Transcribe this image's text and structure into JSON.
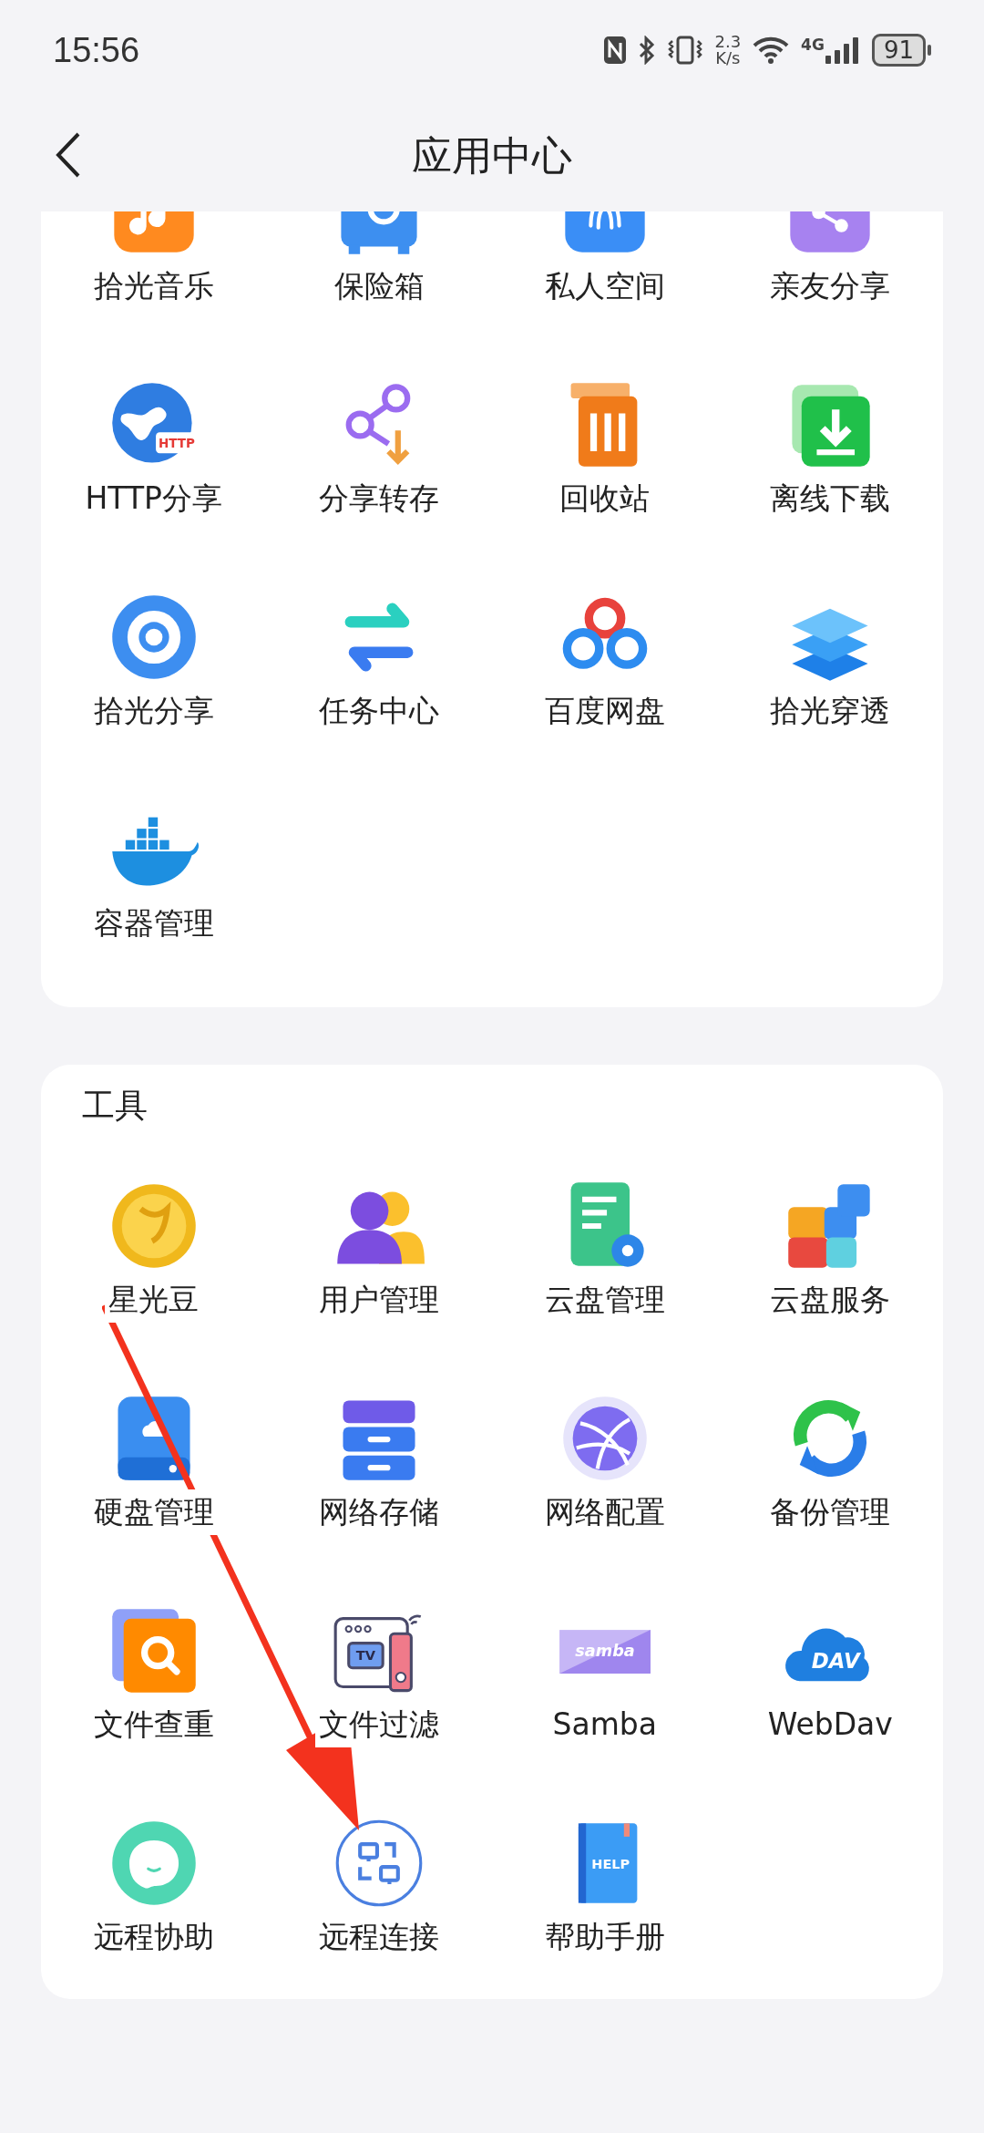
{
  "status_bar": {
    "time": "15:56",
    "speed_value": "2.3",
    "speed_unit": "K/s",
    "network": "4G",
    "battery": "91"
  },
  "header": {
    "title": "应用中心"
  },
  "sections": [
    {
      "apps": [
        {
          "label": "拾光音乐",
          "kind": "music"
        },
        {
          "label": "保险箱",
          "kind": "safe"
        },
        {
          "label": "私人空间",
          "kind": "private"
        },
        {
          "label": "亲友分享",
          "kind": "friends"
        },
        {
          "label": "HTTP分享",
          "kind": "http",
          "icon_text": "HTTP"
        },
        {
          "label": "分享转存",
          "kind": "sharesave"
        },
        {
          "label": "回收站",
          "kind": "recycle"
        },
        {
          "label": "离线下载",
          "kind": "offline"
        },
        {
          "label": "拾光分享",
          "kind": "ring"
        },
        {
          "label": "任务中心",
          "kind": "tasks"
        },
        {
          "label": "百度网盘",
          "kind": "baidu"
        },
        {
          "label": "拾光穿透",
          "kind": "layers"
        },
        {
          "label": "容器管理",
          "kind": "docker"
        }
      ]
    },
    {
      "title": "工具",
      "apps": [
        {
          "label": "星光豆",
          "kind": "coin"
        },
        {
          "label": "用户管理",
          "kind": "users"
        },
        {
          "label": "云盘管理",
          "kind": "docgear"
        },
        {
          "label": "云盘服务",
          "kind": "puzzle"
        },
        {
          "label": "硬盘管理",
          "kind": "disk"
        },
        {
          "label": "网络存储",
          "kind": "nas"
        },
        {
          "label": "网络配置",
          "kind": "globe"
        },
        {
          "label": "备份管理",
          "kind": "sync"
        },
        {
          "label": "文件查重",
          "kind": "dedupe"
        },
        {
          "label": "文件过滤",
          "kind": "tv",
          "icon_text": "TV"
        },
        {
          "label": "Samba",
          "kind": "samba",
          "icon_text": "samba"
        },
        {
          "label": "WebDav",
          "kind": "dav",
          "icon_text": "DAV"
        },
        {
          "label": "远程协助",
          "kind": "chat"
        },
        {
          "label": "远程连接",
          "kind": "remote"
        },
        {
          "label": "帮助手册",
          "kind": "help",
          "icon_text": "HELP"
        }
      ]
    }
  ]
}
